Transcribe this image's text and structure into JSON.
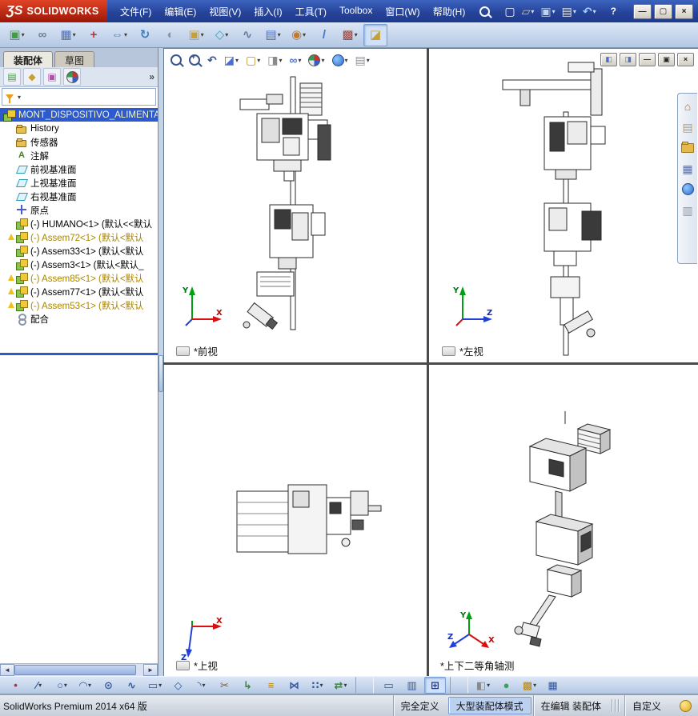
{
  "app": {
    "logo_mark": "ƷS",
    "logo_name": "SOLIDWORKS"
  },
  "titlebar": {
    "menu": [
      {
        "name": "menu-file",
        "label": "文件(F)"
      },
      {
        "name": "menu-edit",
        "label": "编辑(E)"
      },
      {
        "name": "menu-view",
        "label": "视图(V)"
      },
      {
        "name": "menu-insert",
        "label": "插入(I)"
      },
      {
        "name": "menu-tools",
        "label": "工具(T)"
      },
      {
        "name": "menu-toolbox",
        "label": "Toolbox"
      },
      {
        "name": "menu-window",
        "label": "窗口(W)"
      },
      {
        "name": "menu-help",
        "label": "帮助(H)"
      }
    ],
    "quick_icons": [
      {
        "name": "new-document-icon",
        "glyph": "▢",
        "color": "#f4f7fb"
      },
      {
        "name": "open-icon",
        "glyph": "▱",
        "color": "#f2c94c",
        "dd": true
      },
      {
        "name": "save-icon",
        "glyph": "▣",
        "color": "#bcd2f0",
        "dd": true
      },
      {
        "name": "print-icon",
        "glyph": "▤",
        "color": "#dfe6f2",
        "dd": true
      },
      {
        "name": "undo-icon",
        "glyph": "↶",
        "color": "#9fd0ff",
        "dd": true
      }
    ],
    "help_label": "?",
    "window_buttons": [
      {
        "name": "minimize-button",
        "glyph": "—"
      },
      {
        "name": "maximize-button",
        "glyph": "▢"
      },
      {
        "name": "close-button",
        "glyph": "×"
      }
    ]
  },
  "assembly_toolbar": {
    "items": [
      {
        "name": "insert-components-icon",
        "glyph": "▣",
        "color": "#3f9e3f",
        "dd": true
      },
      {
        "name": "mate-icon",
        "glyph": "∞",
        "color": "#6f7f96"
      },
      {
        "name": "linear-component-pattern-icon",
        "glyph": "▦",
        "color": "#4a6fd0",
        "dd": true
      },
      {
        "name": "smart-fasteners-icon",
        "glyph": "+",
        "color": "#b03a3a"
      },
      {
        "name": "move-component-icon",
        "glyph": "⇔",
        "color": "#3f7fbf",
        "dd": true
      },
      {
        "name": "rotate-component-icon",
        "glyph": "↻",
        "color": "#3f7fbf"
      },
      {
        "name": "show-hidden-components-icon",
        "glyph": "◐",
        "color": "#8a93a6"
      },
      {
        "name": "assembly-features-icon",
        "glyph": "▣",
        "color": "#c8a030",
        "dd": true
      },
      {
        "name": "reference-geometry-icon",
        "glyph": "◇",
        "color": "#2fa7c7",
        "dd": true
      },
      {
        "name": "new-motion-study-icon",
        "glyph": "∿",
        "color": "#6a7a9a"
      },
      {
        "name": "bill-of-materials-icon",
        "glyph": "▤",
        "color": "#4a6fd0",
        "dd": true
      },
      {
        "name": "exploded-view-icon",
        "glyph": "◉",
        "color": "#c8772a",
        "dd": true
      },
      {
        "name": "explode-line-sketch-icon",
        "glyph": "/",
        "color": "#4a6fd0"
      },
      {
        "name": "interference-detection-icon",
        "glyph": "▩",
        "color": "#a04030",
        "dd": true
      },
      {
        "name": "instant3d-icon",
        "glyph": "◪",
        "color": "#c8a030",
        "active": true
      }
    ]
  },
  "panel": {
    "tabs": [
      {
        "name": "tab-assembly",
        "label": "装配体",
        "active": true
      },
      {
        "name": "tab-sketch",
        "label": "草图"
      }
    ],
    "manager_tabs": [
      {
        "name": "featuremanager-tab-icon",
        "glyph": "▤",
        "color": "#3f9e3f"
      },
      {
        "name": "propertymanager-tab-icon",
        "glyph": "◆",
        "color": "#c8a030"
      },
      {
        "name": "configurationmanager-tab-icon",
        "glyph": "▣",
        "color": "#b052a8"
      },
      {
        "name": "displaymanager-tab-icon",
        "cls": "i-ball"
      }
    ],
    "overflow_label": "»",
    "tree": {
      "root_label": "MONT_DISPOSITIVO_ALIMENTAD",
      "items": [
        {
          "name": "tree-item-history",
          "label": "History",
          "type": "history"
        },
        {
          "name": "tree-item-sensors",
          "label": "传感器",
          "type": "sensors"
        },
        {
          "name": "tree-item-annotations",
          "label": "注解",
          "type": "annotations"
        },
        {
          "name": "tree-item-front-plane",
          "label": "前视基准面",
          "type": "plane"
        },
        {
          "name": "tree-item-top-plane",
          "label": "上视基准面",
          "type": "plane"
        },
        {
          "name": "tree-item-right-plane",
          "label": "右视基准面",
          "type": "plane"
        },
        {
          "name": "tree-item-origin",
          "label": "原点",
          "type": "origin"
        },
        {
          "name": "tree-item-humano",
          "label": "(-) HUMANO<1> (默认<<默认",
          "type": "component"
        },
        {
          "name": "tree-item-assem72",
          "label": "(-) Assem72<1> (默认<默认",
          "type": "component",
          "warn": true,
          "orange": true
        },
        {
          "name": "tree-item-assem33",
          "label": "(-) Assem33<1> (默认<默认",
          "type": "component"
        },
        {
          "name": "tree-item-assem3",
          "label": "(-) Assem3<1> (默认<默认_",
          "type": "component"
        },
        {
          "name": "tree-item-assem85",
          "label": "(-) Assem85<1> (默认<默认",
          "type": "component",
          "warn": true,
          "orange": true
        },
        {
          "name": "tree-item-assem77",
          "label": "(-) Assem77<1> (默认<默认",
          "type": "component",
          "warn": true
        },
        {
          "name": "tree-item-assem53",
          "label": "(-) Assem53<1> (默认<默认",
          "type": "component",
          "warn": true,
          "orange": true
        },
        {
          "name": "tree-item-mates",
          "label": "配合",
          "type": "mates"
        }
      ]
    },
    "scrollbar": {
      "left_arrow": "◄",
      "right_arrow": "►"
    }
  },
  "viewport": {
    "headsup": [
      {
        "name": "zoom-to-fit-icon",
        "cls": "i-mag"
      },
      {
        "name": "zoom-to-area-icon",
        "cls": "i-mag i-magp"
      },
      {
        "name": "previous-view-icon",
        "glyph": "↶",
        "color": "#38568a"
      },
      {
        "name": "section-view-icon",
        "glyph": "◪",
        "color": "#4a6fd0",
        "dd": true
      },
      {
        "name": "view-orientation-icon",
        "glyph": "▢",
        "color": "#b8912a",
        "dd": true
      },
      {
        "name": "display-style-icon",
        "glyph": "◨",
        "color": "#8a8a8a",
        "dd": true
      },
      {
        "name": "hide-show-items-icon",
        "glyph": "∞",
        "color": "#4a6fd0",
        "dd": true
      },
      {
        "name": "edit-appearance-icon",
        "cls": "i-ball",
        "dd": true
      },
      {
        "name": "apply-scene-icon",
        "cls": "i-globe",
        "dd": true
      },
      {
        "name": "view-settings-icon",
        "glyph": "▤",
        "color": "#7a93c0",
        "dd": true
      }
    ],
    "window_buttons": [
      {
        "name": "split-left-button",
        "glyph": "◧",
        "color": "#4a6fd0"
      },
      {
        "name": "split-right-button",
        "glyph": "◨",
        "color": "#4a6fd0"
      },
      {
        "name": "minimize-document-button",
        "glyph": "—",
        "color": "#222"
      },
      {
        "name": "restore-document-button",
        "glyph": "▣",
        "color": "#222"
      },
      {
        "name": "close-document-button",
        "glyph": "×",
        "color": "#222"
      }
    ],
    "taskpane": [
      {
        "name": "solidworks-resources-icon",
        "glyph": "⌂",
        "color": "#b8702a"
      },
      {
        "name": "design-library-icon",
        "glyph": "▤",
        "color": "#c8a030"
      },
      {
        "name": "file-explorer-icon",
        "cls": "i-folder"
      },
      {
        "name": "view-palette-icon",
        "glyph": "▦",
        "color": "#4a6fd0"
      },
      {
        "name": "appearances-icon",
        "cls": "i-globe"
      },
      {
        "name": "custom-properties-icon",
        "glyph": "▥",
        "color": "#8a93a6"
      }
    ],
    "views": [
      {
        "label": "*前视"
      },
      {
        "label": "*左视"
      },
      {
        "label": "*上视"
      },
      {
        "label": "*上下二等角轴测"
      }
    ],
    "axes": {
      "x": "X",
      "y": "Y",
      "z": "Z"
    }
  },
  "sketch_toolbar": {
    "items": [
      {
        "name": "sketch-point-icon",
        "glyph": "•",
        "color": "#aa3333"
      },
      {
        "name": "sketch-line-icon",
        "glyph": "∕",
        "color": "#33589e",
        "dd": true
      },
      {
        "name": "sketch-circle-icon",
        "glyph": "○",
        "color": "#33589e",
        "dd": true
      },
      {
        "name": "sketch-arc-icon",
        "glyph": "◠",
        "color": "#33589e",
        "dd": true
      },
      {
        "name": "sketch-ellipse-icon",
        "glyph": "⊙",
        "color": "#33589e"
      },
      {
        "name": "sketch-spline-icon",
        "glyph": "∿",
        "color": "#33589e"
      },
      {
        "name": "sketch-rectangle-icon",
        "glyph": "▭",
        "color": "#33589e",
        "dd": true
      },
      {
        "name": "sketch-polygon-icon",
        "glyph": "◇",
        "color": "#33589e"
      },
      {
        "name": "sketch-fillet-icon",
        "glyph": "◝",
        "color": "#33589e",
        "dd": true
      },
      {
        "name": "trim-entities-icon",
        "glyph": "✂",
        "color": "#8a5a2a"
      },
      {
        "name": "convert-entities-icon",
        "glyph": "↳",
        "color": "#3f7f3f"
      },
      {
        "name": "offset-entities-icon",
        "glyph": "≡",
        "color": "#b8860b"
      },
      {
        "name": "mirror-entities-icon",
        "glyph": "⋈",
        "color": "#33589e"
      },
      {
        "name": "linear-sketch-pattern-icon",
        "glyph": "∷",
        "color": "#33589e",
        "dd": true
      },
      {
        "name": "move-entities-icon",
        "glyph": "⇄",
        "color": "#3f7f3f",
        "dd": true
      },
      {
        "sep": true
      },
      {
        "name": "single-view-button",
        "glyph": "▭",
        "color": "#33589e"
      },
      {
        "name": "two-view-button",
        "glyph": "▥",
        "color": "#33589e"
      },
      {
        "name": "four-view-button",
        "glyph": "⊞",
        "color": "#1a3a8a",
        "active": true
      },
      {
        "sep": true
      },
      {
        "name": "display-style-button",
        "glyph": "◧",
        "color": "#8a8a8a",
        "dd": true
      },
      {
        "name": "edit-appearance-button",
        "glyph": "●",
        "color": "#3f9e5f"
      },
      {
        "name": "apply-scene-button",
        "glyph": "▩",
        "color": "#b8860b",
        "dd": true
      },
      {
        "name": "grid-button",
        "glyph": "▦",
        "color": "#33589e"
      }
    ]
  },
  "statusbar": {
    "app_version": "SolidWorks Premium 2014 x64 版",
    "define_status": "完全定义",
    "assembly_mode": "大型装配体模式",
    "edit_status": "在编辑 装配体",
    "customize_label": "自定义"
  }
}
